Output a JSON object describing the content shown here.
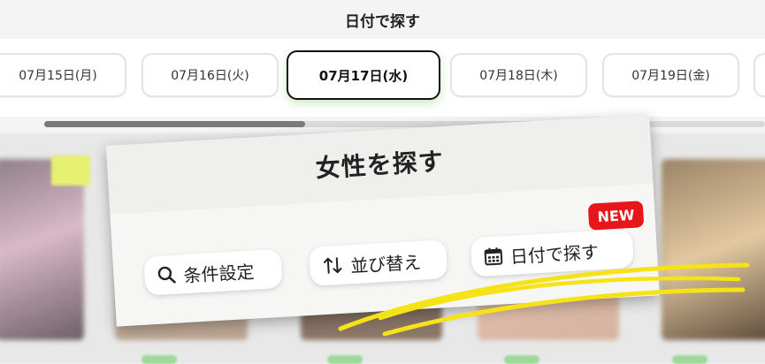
{
  "header": {
    "title": "日付で探す"
  },
  "dates": [
    {
      "label": "07月15日(月)",
      "selected": false
    },
    {
      "label": "07月16日(火)",
      "selected": false
    },
    {
      "label": "07月17日(水)",
      "selected": true
    },
    {
      "label": "07月18日(木)",
      "selected": false
    },
    {
      "label": "07月19日(金)",
      "selected": false
    }
  ],
  "overlay": {
    "title": "女性を探す",
    "buttons": [
      {
        "label": "条件設定",
        "icon": "search-icon"
      },
      {
        "label": "並び替え",
        "icon": "sort-icon"
      },
      {
        "label": "日付で探す",
        "icon": "calendar-icon"
      }
    ],
    "badge": "NEW"
  },
  "colors": {
    "accent_badge": "#e8151b",
    "highlight_scribble": "#f5e318",
    "selected_border": "#111111",
    "selected_glow": "#8cd26e"
  }
}
